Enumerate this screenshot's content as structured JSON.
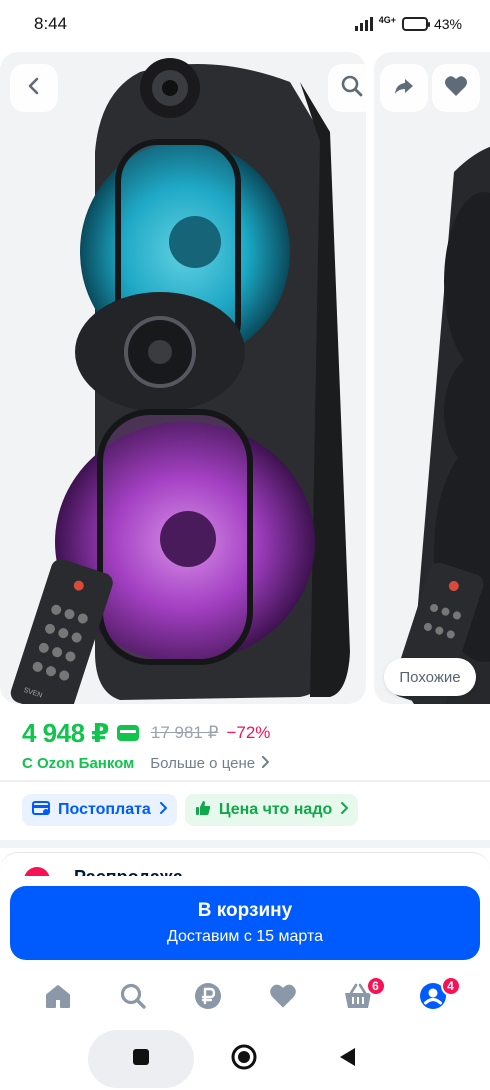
{
  "status": {
    "time": "8:44",
    "network": "4G+",
    "battery_label": "43%",
    "battery_level": 0.43
  },
  "gallery": {
    "back_icon": "chevron-left-icon",
    "search_icon": "search-icon",
    "share_icon": "share-icon",
    "favorite_icon": "heart-icon",
    "similar_label": "Похожие",
    "product_brand": "SVEN"
  },
  "price": {
    "current": "4 948 ₽",
    "old": "17 981 ₽",
    "discount": "−72%",
    "bank_label": "С Ozon Банком",
    "more_label": "Больше о цене"
  },
  "chips": [
    {
      "label": "Постоплата",
      "icon": "card-icon"
    },
    {
      "label": "Цена что надо",
      "icon": "thumbs-up-icon"
    }
  ],
  "next_section": {
    "title": "Распродажа"
  },
  "cart": {
    "label": "В корзину",
    "delivery": "Доставим с 15 марта"
  },
  "tabbar": {
    "items": [
      {
        "name": "home",
        "icon": "home-icon"
      },
      {
        "name": "search",
        "icon": "search-icon"
      },
      {
        "name": "finance",
        "icon": "ruble-icon"
      },
      {
        "name": "favorites",
        "icon": "heart-icon"
      },
      {
        "name": "cart",
        "icon": "basket-icon",
        "badge": "6"
      },
      {
        "name": "profile",
        "icon": "profile-icon",
        "badge": "4"
      }
    ]
  },
  "colors": {
    "accent_blue": "#005bff",
    "price_green": "#10c44c",
    "discount_red": "#f91155"
  }
}
